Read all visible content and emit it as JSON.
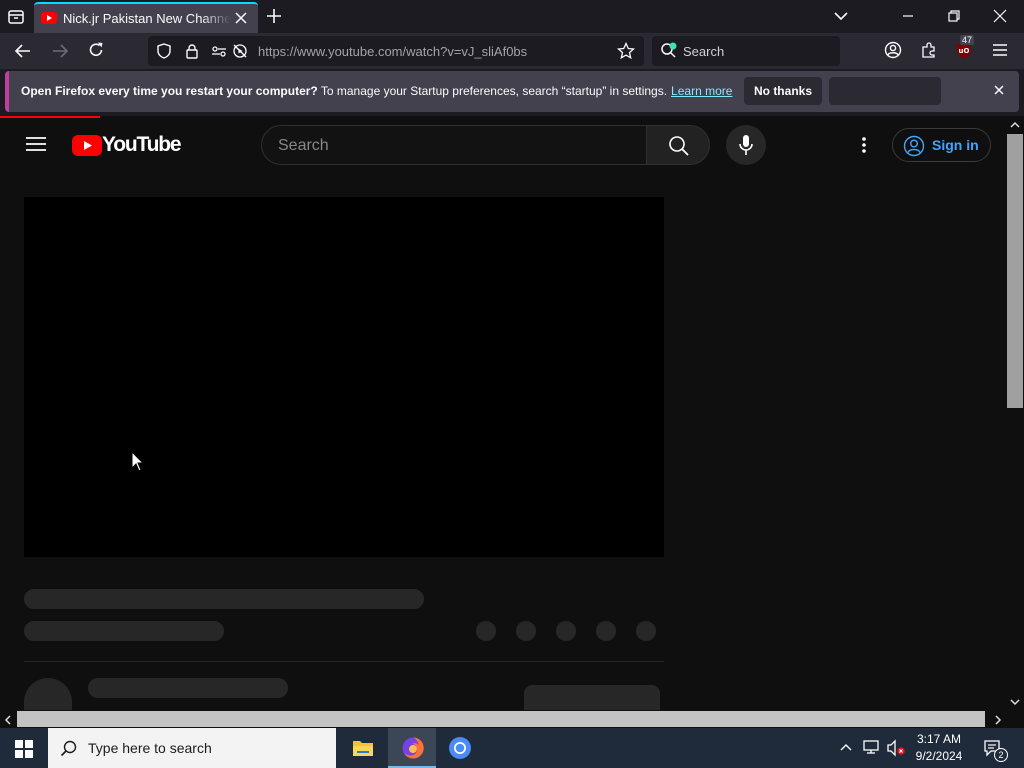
{
  "browser": {
    "tab": {
      "title": "Nick.jr Pakistan New Channel Co"
    },
    "url": "https://www.youtube.com/watch?v=vJ_sliAf0bs",
    "search_placeholder": "Search",
    "extension_badge": "47"
  },
  "notification": {
    "bold_text": "Open Firefox every time you restart your computer?",
    "text": " To manage your Startup preferences, search “startup” in settings.",
    "link": "Learn more",
    "no_thanks": "No thanks"
  },
  "youtube": {
    "logo_text": "YouTube",
    "search_placeholder": "Search",
    "sign_in": "Sign in"
  },
  "taskbar": {
    "search_placeholder": "Type here to search",
    "time": "3:17 AM",
    "date": "9/2/2024",
    "notification_count": "2"
  }
}
